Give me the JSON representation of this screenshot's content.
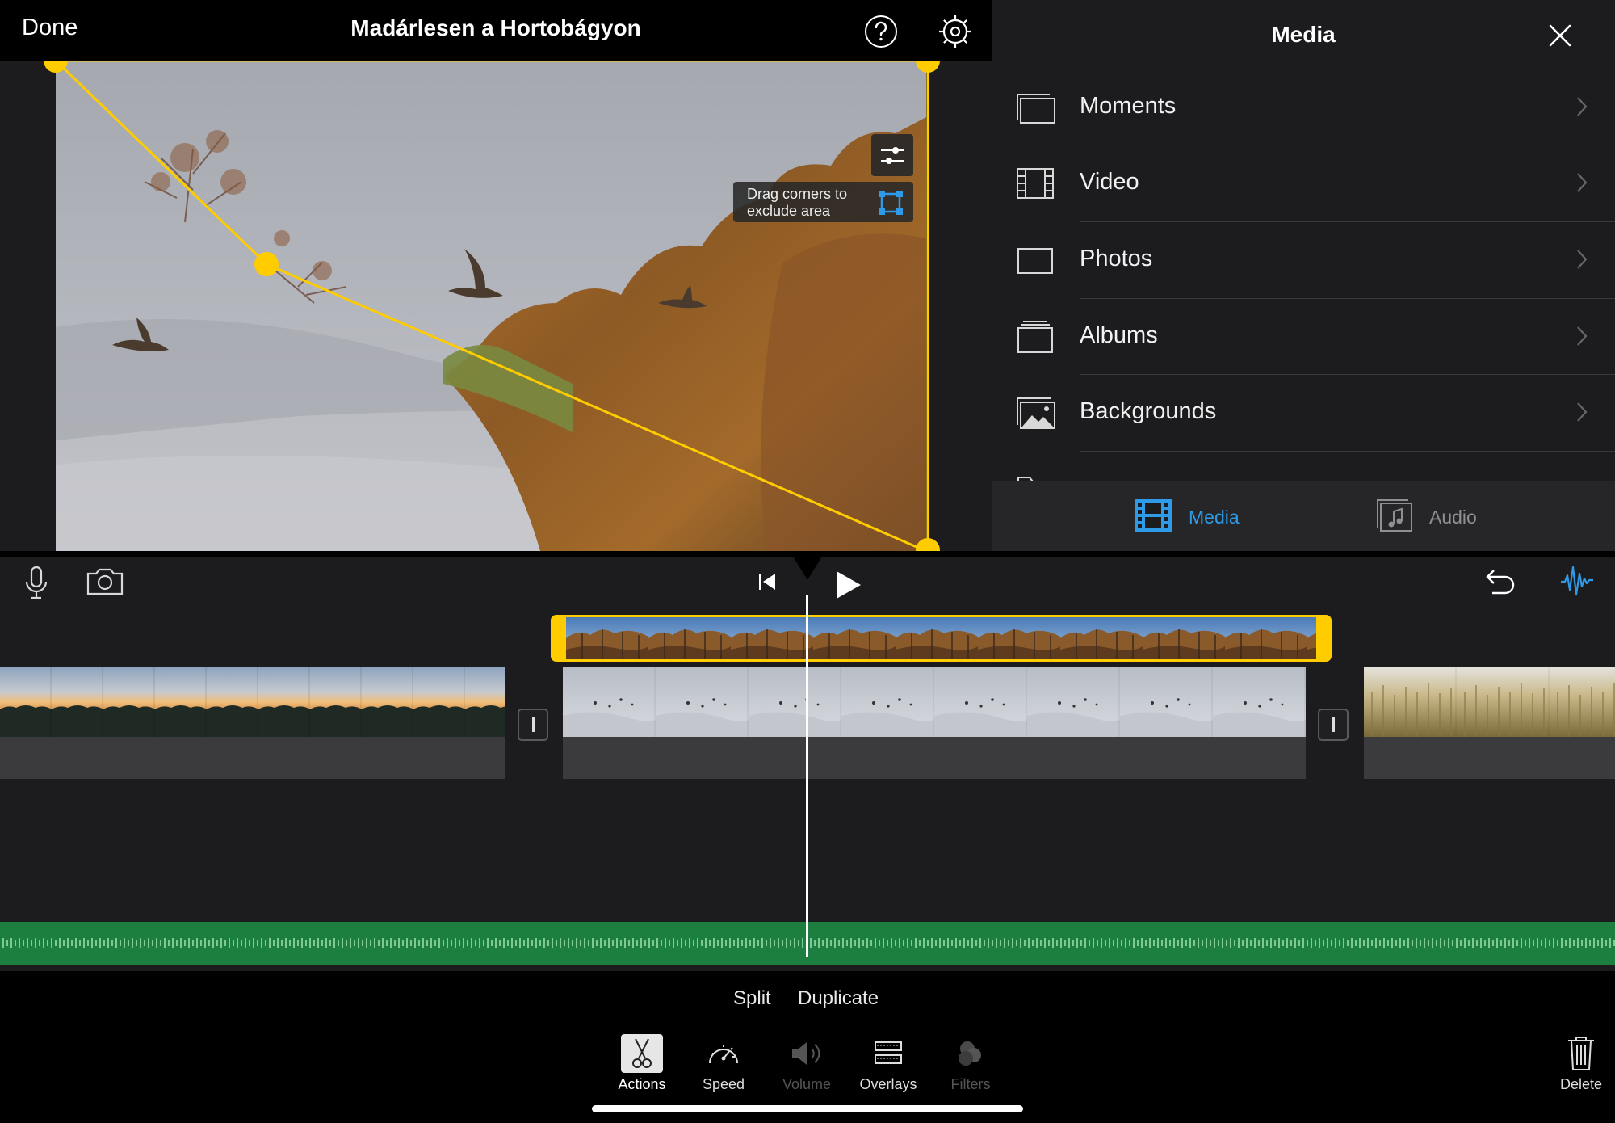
{
  "header": {
    "done_label": "Done",
    "project_title": "Madárlesen a Hortobágyon"
  },
  "viewer": {
    "hint_text": "Drag corners to exclude area"
  },
  "media_panel": {
    "title": "Media",
    "items": [
      {
        "label": "Moments",
        "icon": "moments-icon"
      },
      {
        "label": "Video",
        "icon": "film-icon"
      },
      {
        "label": "Photos",
        "icon": "photo-frame-icon"
      },
      {
        "label": "Albums",
        "icon": "album-stack-icon"
      },
      {
        "label": "Backgrounds",
        "icon": "background-image-icon"
      }
    ],
    "tabs": [
      {
        "label": "Media",
        "icon": "film-tab-icon",
        "active": true
      },
      {
        "label": "Audio",
        "icon": "music-note-icon",
        "active": false
      }
    ]
  },
  "actions": {
    "split_label": "Split",
    "duplicate_label": "Duplicate"
  },
  "toolbar": {
    "tools": [
      {
        "label": "Actions",
        "icon": "scissors-icon",
        "selected": true,
        "enabled": true
      },
      {
        "label": "Speed",
        "icon": "speedometer-icon",
        "selected": false,
        "enabled": true
      },
      {
        "label": "Volume",
        "icon": "speaker-icon",
        "selected": false,
        "enabled": false
      },
      {
        "label": "Overlays",
        "icon": "overlays-icon",
        "selected": false,
        "enabled": true
      },
      {
        "label": "Filters",
        "icon": "filters-icon",
        "selected": false,
        "enabled": false
      }
    ],
    "delete_label": "Delete"
  },
  "colors": {
    "accent_yellow": "#ffcc00",
    "accent_blue": "#2f9be8",
    "audio_green": "#1d7f3f",
    "panel_bg": "#1c1c1e"
  }
}
